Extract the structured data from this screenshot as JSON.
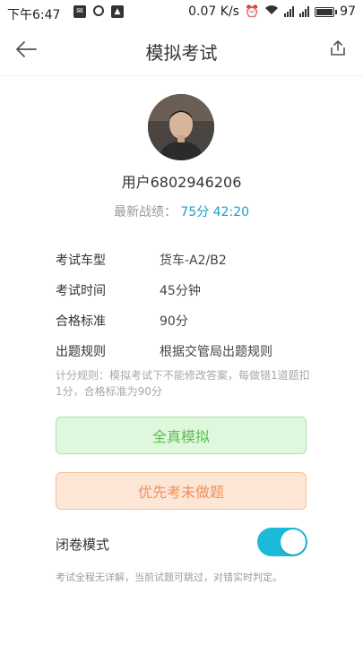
{
  "status_bar": {
    "time": "下午6:47",
    "net_speed": "0.07 K/s",
    "battery": "97"
  },
  "header": {
    "title": "模拟考试"
  },
  "profile": {
    "username": "用户6802946206",
    "record_label": "最新战绩：",
    "record_value": "75分 42:20"
  },
  "info": [
    {
      "label": "考试车型",
      "value": "货车-A2/B2"
    },
    {
      "label": "考试时间",
      "value": "45分钟"
    },
    {
      "label": "合格标准",
      "value": "90分"
    },
    {
      "label": "出题规则",
      "value": "根据交管局出题规则"
    }
  ],
  "rules_text": "计分规则：模拟考试下不能修改答案，每做错1道题扣1分，合格标准为90分",
  "buttons": {
    "simulate": "全真模拟",
    "undone_first": "优先考未做题"
  },
  "closed_mode": {
    "label": "闭卷模式",
    "enabled": true
  },
  "note": "考试全程无详解，当前试题可跳过，对错实时判定。",
  "colors": {
    "accent": "#1a9ecb",
    "toggle_on": "#1bbad8",
    "green_button_bg": "#dff7dc",
    "orange_button_bg": "#fde6d5"
  }
}
